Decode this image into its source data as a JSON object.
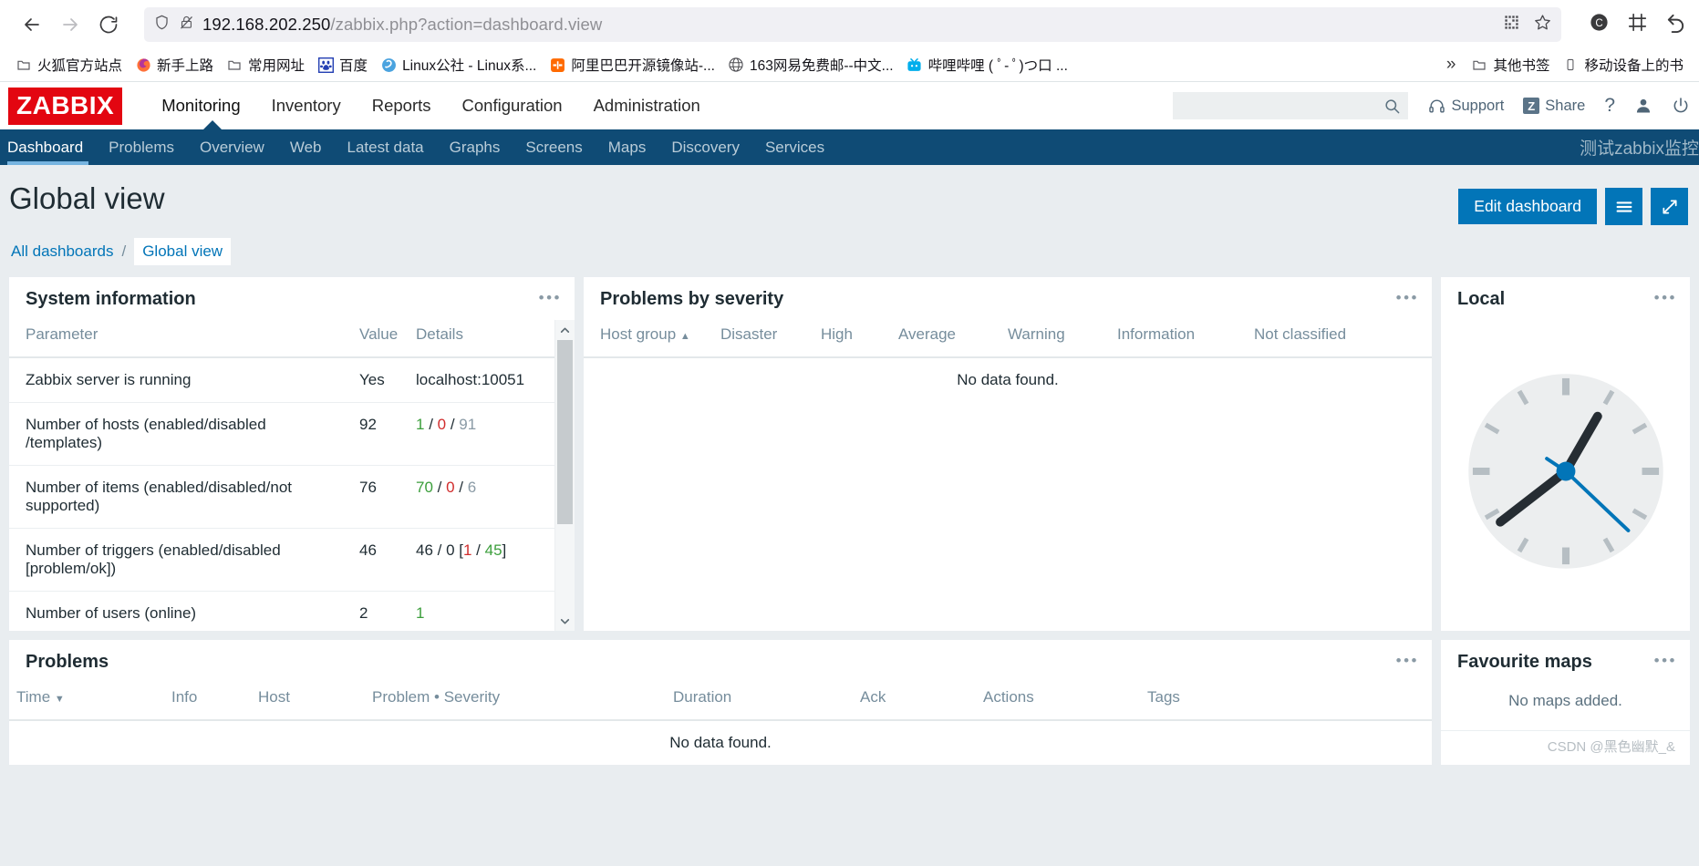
{
  "browser": {
    "url_host": "192.168.202.250",
    "url_path": "/zabbix.php?action=dashboard.view",
    "back_icon": "back-arrow-icon",
    "forward_icon": "forward-arrow-icon",
    "reload_icon": "reload-icon",
    "shield_icon": "shield-icon",
    "lock_broken_icon": "lock-crossed-icon",
    "qr_icon": "qr-code-icon",
    "star_icon": "star-icon",
    "container_icon": "container-tab-icon",
    "screenshot_icon": "screenshot-icon",
    "undo_icon": "undo-icon",
    "bookmarks": [
      {
        "label": "火狐官方站点",
        "icon": "folder-icon"
      },
      {
        "label": "新手上路",
        "icon": "firefox-icon"
      },
      {
        "label": "常用网址",
        "icon": "folder-icon"
      },
      {
        "label": "百度",
        "icon": "baidu-icon"
      },
      {
        "label": "Linux公社 - Linux系...",
        "icon": "linux-site-icon"
      },
      {
        "label": "阿里巴巴开源镜像站-...",
        "icon": "aliyun-icon"
      },
      {
        "label": "163网易免费邮--中文...",
        "icon": "netease-icon"
      },
      {
        "label": "哔哩哔哩 ( ﾟ- ﾟ)つ口 ...",
        "icon": "bilibili-icon"
      }
    ],
    "overflow_label": "»",
    "other_bookmarks": {
      "label": "其他书签",
      "icon": "folder-icon"
    },
    "mobile_bookmarks": {
      "label": "移动设备上的书",
      "icon": "mobile-icon"
    }
  },
  "header": {
    "logo": "ZABBIX",
    "nav": [
      {
        "label": "Monitoring",
        "active": true
      },
      {
        "label": "Inventory",
        "active": false
      },
      {
        "label": "Reports",
        "active": false
      },
      {
        "label": "Configuration",
        "active": false
      },
      {
        "label": "Administration",
        "active": false
      }
    ],
    "search_placeholder": "",
    "search_value": "",
    "search_icon": "search-icon",
    "support_label": "Support",
    "support_icon": "headset-icon",
    "share_label": "Share",
    "share_badge": "Z",
    "help_label": "?",
    "user_icon": "user-icon",
    "signout_icon": "power-icon"
  },
  "subnav": {
    "items": [
      {
        "label": "Dashboard",
        "active": true
      },
      {
        "label": "Problems",
        "active": false
      },
      {
        "label": "Overview",
        "active": false
      },
      {
        "label": "Web",
        "active": false
      },
      {
        "label": "Latest data",
        "active": false
      },
      {
        "label": "Graphs",
        "active": false
      },
      {
        "label": "Screens",
        "active": false
      },
      {
        "label": "Maps",
        "active": false
      },
      {
        "label": "Discovery",
        "active": false
      },
      {
        "label": "Services",
        "active": false
      }
    ],
    "right_text": "测试zabbix监控"
  },
  "page": {
    "title": "Global view",
    "edit_button": "Edit dashboard",
    "menu_icon": "hamburger-menu-icon",
    "fullscreen_icon": "expand-arrows-icon",
    "breadcrumb": {
      "all_dashboards": "All dashboards",
      "separator": "/",
      "current": "Global view"
    }
  },
  "widgets": {
    "system_information": {
      "title": "System information",
      "columns": [
        "Parameter",
        "Value",
        "Details"
      ],
      "rows": [
        {
          "parameter": "Zabbix server is running",
          "value": "Yes",
          "value_color": "green",
          "details": [
            {
              "text": "localhost:10051",
              "color": "default"
            }
          ]
        },
        {
          "parameter": "Number of hosts (enabled/disabled /templates)",
          "value": "92",
          "value_color": "default",
          "details": [
            {
              "text": "1",
              "color": "green"
            },
            {
              "text": " / ",
              "color": "default"
            },
            {
              "text": "0",
              "color": "red"
            },
            {
              "text": " / ",
              "color": "default"
            },
            {
              "text": "91",
              "color": "grey"
            }
          ]
        },
        {
          "parameter": "Number of items (enabled/disabled/not supported)",
          "value": "76",
          "value_color": "default",
          "details": [
            {
              "text": "70",
              "color": "green"
            },
            {
              "text": " / ",
              "color": "default"
            },
            {
              "text": "0",
              "color": "red"
            },
            {
              "text": " / ",
              "color": "default"
            },
            {
              "text": "6",
              "color": "grey"
            }
          ]
        },
        {
          "parameter": "Number of triggers (enabled/disabled [problem/ok])",
          "value": "46",
          "value_color": "default",
          "details": [
            {
              "text": "46 / 0 [",
              "color": "default"
            },
            {
              "text": "1",
              "color": "red"
            },
            {
              "text": " / ",
              "color": "default"
            },
            {
              "text": "45",
              "color": "green"
            },
            {
              "text": "]",
              "color": "default"
            }
          ]
        },
        {
          "parameter": "Number of users (online)",
          "value": "2",
          "value_color": "default",
          "details": [
            {
              "text": "1",
              "color": "green"
            }
          ]
        }
      ],
      "scroll_up_icon": "chevron-up-icon",
      "scroll_down_icon": "chevron-down-icon"
    },
    "problems_by_severity": {
      "title": "Problems by severity",
      "columns": [
        "Host group",
        "Disaster",
        "High",
        "Average",
        "Warning",
        "Information",
        "Not classified"
      ],
      "sort_column": "Host group",
      "sort_direction": "asc",
      "sort_arrow": "▲",
      "empty_text": "No data found."
    },
    "local_clock": {
      "title": "Local",
      "hour": 1,
      "minute": 40,
      "second": 23,
      "face_color": "#eceeef",
      "hand_color": "#262d33",
      "second_hand_color": "#0275b8"
    },
    "problems": {
      "title": "Problems",
      "columns": [
        "Time",
        "Info",
        "Host",
        "Problem • Severity",
        "Duration",
        "Ack",
        "Actions",
        "Tags"
      ],
      "sort_column": "Time",
      "sort_direction": "desc",
      "sort_arrow": "▼",
      "empty_text": "No data found."
    },
    "favourite_maps": {
      "title": "Favourite maps",
      "empty_text": "No maps added."
    }
  },
  "watermark": "CSDN @黑色幽默_&",
  "colors": {
    "brand_red": "#e30611",
    "nav_blue": "#0f4b75",
    "accent_blue": "#0275b8",
    "page_bg": "#e9edf0"
  }
}
